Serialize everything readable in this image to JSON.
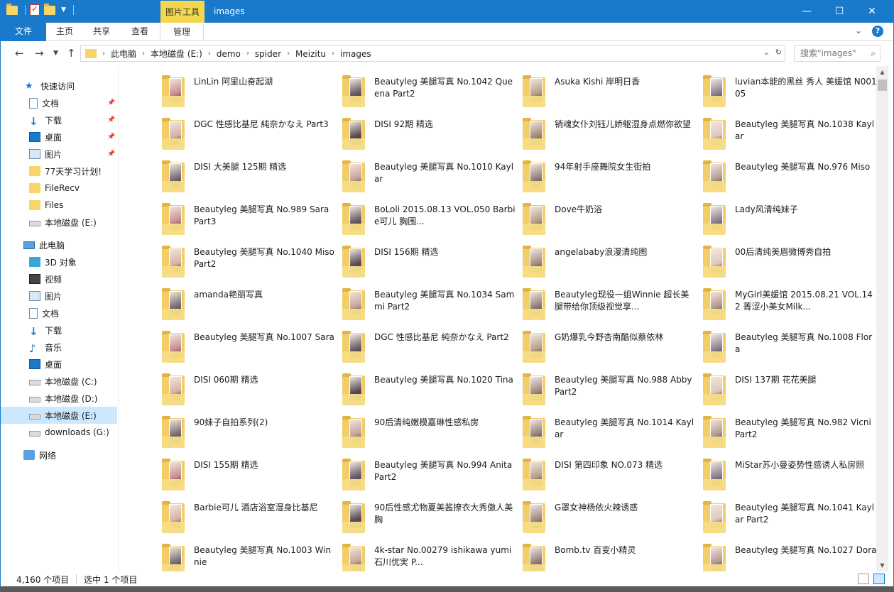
{
  "titlebar": {
    "context_tab": "图片工具",
    "title": "images",
    "minimize": "—",
    "maximize": "☐",
    "close": "✕"
  },
  "ribbon": {
    "tabs": [
      "文件",
      "主页",
      "共享",
      "查看",
      "管理"
    ]
  },
  "address": {
    "crumbs": [
      "此电脑",
      "本地磁盘 (E:)",
      "demo",
      "spider",
      "Meizitu",
      "images"
    ],
    "search_placeholder": "搜索\"images\""
  },
  "sidebar": {
    "quick_access": "快速访问",
    "items": [
      {
        "label": "文档",
        "icon": "document-icon",
        "pinned": true
      },
      {
        "label": "下载",
        "icon": "download-icon",
        "pinned": true
      },
      {
        "label": "桌面",
        "icon": "desktop-icon",
        "pinned": true
      },
      {
        "label": "图片",
        "icon": "pictures-icon",
        "pinned": true
      },
      {
        "label": "77天学习计划!",
        "icon": "folder-icon"
      },
      {
        "label": "FileRecv",
        "icon": "folder-icon"
      },
      {
        "label": "Files",
        "icon": "folder-icon"
      },
      {
        "label": "本地磁盘 (E:)",
        "icon": "drive-icon"
      }
    ],
    "this_pc": "此电脑",
    "pc_items": [
      {
        "label": "3D 对象",
        "icon": "3d-objects-icon"
      },
      {
        "label": "视频",
        "icon": "videos-icon"
      },
      {
        "label": "图片",
        "icon": "pictures-icon"
      },
      {
        "label": "文档",
        "icon": "document-icon"
      },
      {
        "label": "下载",
        "icon": "download-icon"
      },
      {
        "label": "音乐",
        "icon": "music-icon"
      },
      {
        "label": "桌面",
        "icon": "desktop-icon"
      },
      {
        "label": "本地磁盘 (C:)",
        "icon": "drive-icon"
      },
      {
        "label": "本地磁盘 (D:)",
        "icon": "drive-icon"
      },
      {
        "label": "本地磁盘 (E:)",
        "icon": "drive-icon",
        "selected": true
      },
      {
        "label": "downloads (G:)",
        "icon": "drive-icon"
      }
    ],
    "network": "网络"
  },
  "folders": [
    [
      "LinLin 阿里山奋起湖",
      "Beautyleg 美腿写真 No.1042 Queena Part2",
      "Asuka Kishi 岸明日香",
      "luvian本能的黑丝 秀人 美媛馆 N00105"
    ],
    [
      "DGC 性感比基尼 純奈かなえ Part3",
      "DISI 92期 精选",
      "销魂女仆刘钰儿娇躯湿身点燃你欲望",
      "Beautyleg 美腿写真 No.1038 Kaylar"
    ],
    [
      "DISI 大美腿 125期 精选",
      "Beautyleg 美腿写真 No.1010 Kaylar",
      "94年射手座舞院女生街拍",
      "Beautyleg 美腿写真 No.976 Miso"
    ],
    [
      "Beautyleg 美腿写真 No.989 Sara Part3",
      "BoLoli 2015.08.13 VOL.050 Barbie可儿 胸围...",
      "Dove牛奶浴",
      "Lady风清纯妹子"
    ],
    [
      "Beautyleg 美腿写真 No.1040 Miso Part2",
      "DISI 156期 精选",
      "angelababy浪漫清纯图",
      "00后清纯美眉微博秀自拍"
    ],
    [
      "amanda艳丽写真",
      "Beautyleg 美腿写真 No.1034 Sammi Part2",
      "Beautyleg现役一姐Winnie 超长美腿带给你顶级视觉享...",
      "MyGirl美媛馆 2015.08.21 VOL.142 菁涩小美女Milk..."
    ],
    [
      "Beautyleg 美腿写真 No.1007 Sara",
      "DGC 性感比基尼 純奈かなえ Part2",
      "G奶爆乳今野杏南酷似蔡依林",
      "Beautyleg 美腿写真 No.1008 Flora"
    ],
    [
      "DISI 060期 精选",
      "Beautyleg 美腿写真 No.1020 Tina",
      "Beautyleg 美腿写真 No.988 Abby Part2",
      "DISI 137期 花花美腿"
    ],
    [
      "90妹子自拍系列(2)",
      "90后清纯嫩模嘉琳性感私房",
      "Beautyleg 美腿写真 No.1014 Kaylar",
      "Beautyleg 美腿写真 No.982 Vicni Part2"
    ],
    [
      "DISI 155期 精选",
      "Beautyleg 美腿写真 No.994 Anita Part2",
      "DISI 第四印象 NO.073 精选",
      "MiStar苏小曼姿势性感诱人私房照"
    ],
    [
      "Barbie可儿 酒店浴室湿身比基尼",
      "90后性感尤物夏美酱撩衣大秀傲人美胸",
      "G罩女神杨依火辣诱惑",
      "Beautyleg 美腿写真 No.1041 Kaylar Part2"
    ],
    [
      "Beautyleg 美腿写真 No.1003 Winnie",
      "4k-star No.00279 ishikawa yumi 石川优実 P...",
      "Bomb.tv 百变小精灵",
      "Beautyleg 美腿写真 No.1027 Dora"
    ]
  ],
  "status": {
    "count": "4,160 个项目",
    "selected": "选中 1 个项目"
  },
  "colors": {
    "accent": "#1979ca",
    "context_tab": "#f4d74f",
    "selection": "#cce8ff",
    "folder": "#f3cd67"
  }
}
